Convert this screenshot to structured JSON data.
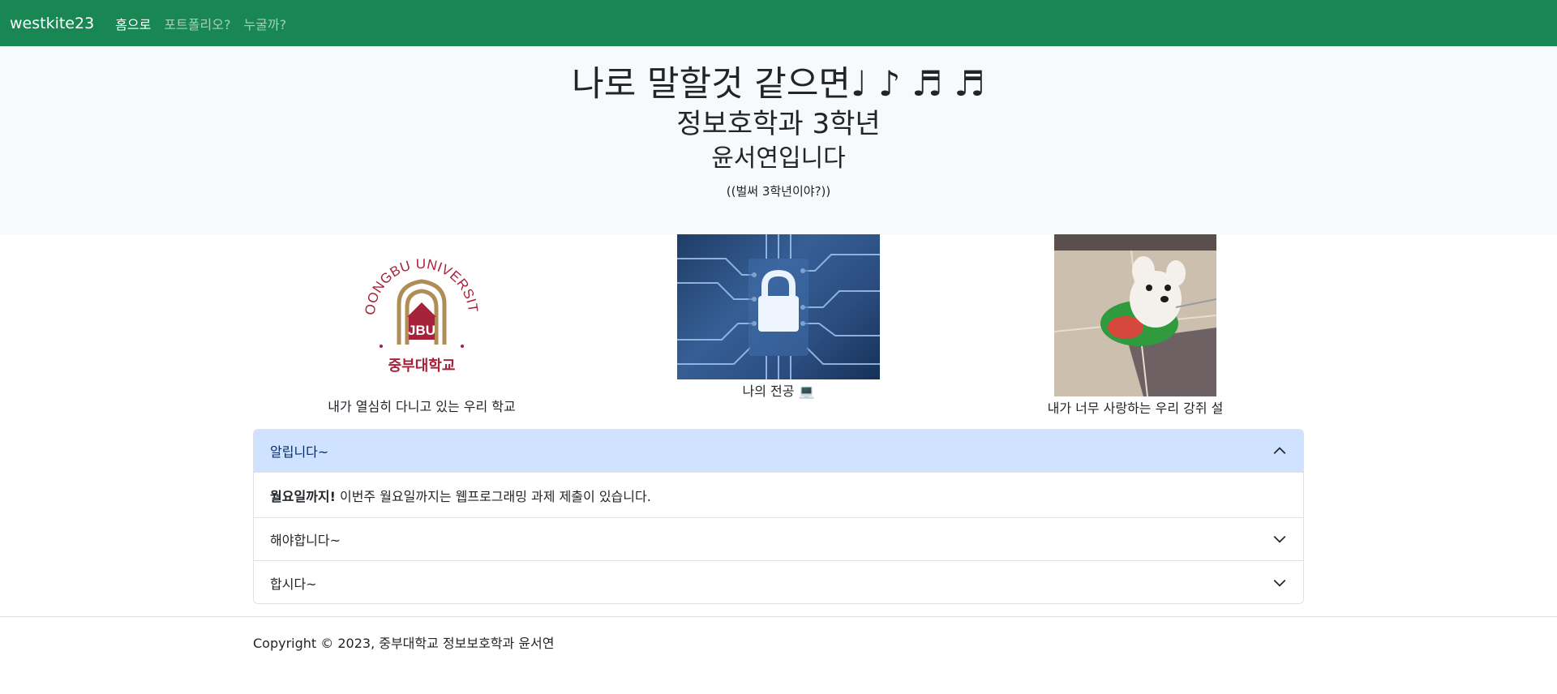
{
  "navbar": {
    "brand": "westkite23",
    "links": [
      {
        "label": "홈으로",
        "active": true
      },
      {
        "label": "포트폴리오?",
        "active": false
      },
      {
        "label": "누굴까?",
        "active": false
      }
    ],
    "bg_color": "#198754"
  },
  "hero": {
    "title": "나로 말할것 같으면♩ ♪ ♬ ♬",
    "subtitle1": "정보호학과 3학년",
    "subtitle2": "윤서연입니다",
    "small": "((벌써 3학년이야?))"
  },
  "gallery": {
    "logo": {
      "university_text": "JOONGBU UNIVERSITY",
      "korean_text": "중부대학교",
      "mark_text": "JBU",
      "caption": "내가 열심히 다니고 있는 우리 학교"
    },
    "major": {
      "caption": "나의 전공 💻"
    },
    "dog": {
      "caption": "내가 너무 사랑하는 우리 강쥐 설"
    }
  },
  "accordion": {
    "items": [
      {
        "title": "알립니다~",
        "open": true,
        "body_bold": "월요일까지!",
        "body_text": " 이번주 월요일까지는 웹프로그래밍 과제 제출이 있습니다."
      },
      {
        "title": "해야합니다~",
        "open": false
      },
      {
        "title": "합시다~",
        "open": false
      }
    ]
  },
  "footer": {
    "text": "Copyright © 2023, 중부대학교 정보보호학과 윤서연"
  }
}
